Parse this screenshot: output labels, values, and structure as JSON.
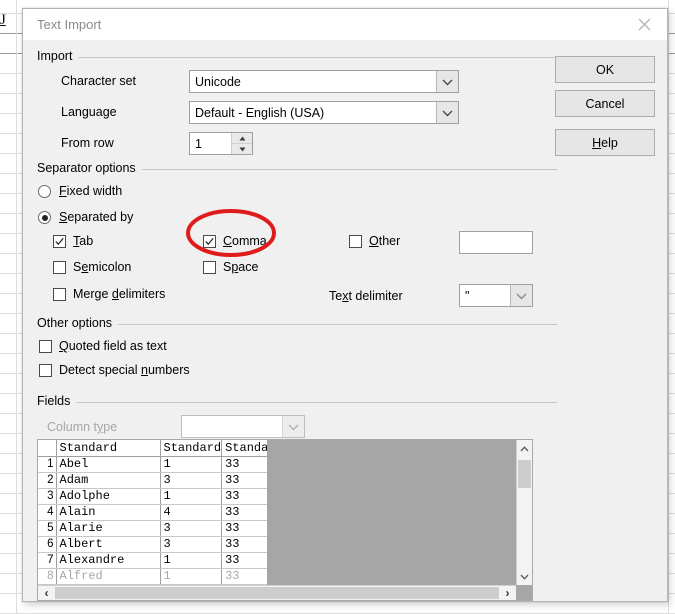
{
  "background": {
    "cell_label": "J"
  },
  "dialog": {
    "title": "Text Import",
    "close_icon": "close-icon"
  },
  "buttons": {
    "ok": "OK",
    "cancel": "Cancel",
    "help": "Help",
    "help_accel": "H"
  },
  "import": {
    "group_label": "Import",
    "charset_label": "Character set",
    "charset_value": "Unicode",
    "language_label": "Language",
    "language_value": "Default - English (USA)",
    "fromrow_label": "From row",
    "fromrow_value": "1"
  },
  "separator": {
    "group_label": "Separator options",
    "fixed_width_label": "Fixed width",
    "fixed_width_checked": false,
    "separated_by_label": "Separated by",
    "separated_by_checked": true,
    "tab_label": "Tab",
    "tab_checked": true,
    "semicolon_label": "Semicolon",
    "semicolon_checked": false,
    "merge_label": "Merge delimiters",
    "merge_checked": false,
    "comma_label": "Comma",
    "comma_checked": true,
    "space_label": "Space",
    "space_checked": false,
    "other_label": "Other",
    "other_checked": false,
    "other_value": "",
    "text_delimiter_label": "Text delimiter",
    "text_delimiter_value": "\""
  },
  "other_options": {
    "group_label": "Other options",
    "quoted_label": "Quoted field as text",
    "quoted_checked": false,
    "detect_label": "Detect special numbers",
    "detect_checked": false
  },
  "fields": {
    "group_label": "Fields",
    "column_type_label": "Column type",
    "column_type_value": "",
    "column_type_disabled": true,
    "headers": [
      "Standard",
      "Standard",
      "Standard"
    ],
    "rows": [
      {
        "n": "1",
        "c1": "Abel",
        "c2": "1",
        "c3": "33"
      },
      {
        "n": "2",
        "c1": "Adam",
        "c2": "3",
        "c3": "33"
      },
      {
        "n": "3",
        "c1": "Adolphe",
        "c2": "1",
        "c3": "33"
      },
      {
        "n": "4",
        "c1": "Alain",
        "c2": "4",
        "c3": "33"
      },
      {
        "n": "5",
        "c1": "Alarie",
        "c2": "3",
        "c3": "33"
      },
      {
        "n": "6",
        "c1": "Albert",
        "c2": "3",
        "c3": "33"
      },
      {
        "n": "7",
        "c1": "Alexandre",
        "c2": "1",
        "c3": "33"
      }
    ]
  },
  "annotation": {
    "shape": "ellipse-highlight",
    "color": "#e01b1b",
    "target": "comma-checkbox"
  }
}
